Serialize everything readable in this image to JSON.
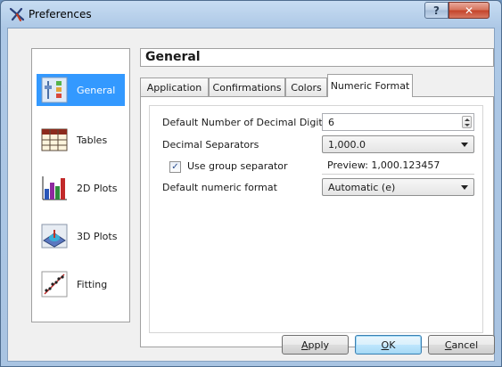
{
  "window": {
    "title": "Preferences",
    "help_glyph": "?",
    "close_glyph": "✕"
  },
  "sidebar": {
    "items": [
      {
        "label": "General",
        "icon": "general-icon",
        "active": true
      },
      {
        "label": "Tables",
        "icon": "tables-icon",
        "active": false
      },
      {
        "label": "2D Plots",
        "icon": "2d-plots-icon",
        "active": false
      },
      {
        "label": "3D Plots",
        "icon": "3d-plots-icon",
        "active": false
      },
      {
        "label": "Fitting",
        "icon": "fitting-icon",
        "active": false
      }
    ]
  },
  "section": {
    "title": "General"
  },
  "tabs": [
    {
      "label": "Application",
      "active": false
    },
    {
      "label": "Confirmations",
      "active": false
    },
    {
      "label": "Colors",
      "active": false
    },
    {
      "label": "Numeric Format",
      "active": true
    }
  ],
  "numeric_format": {
    "decimal_digits_label": "Default Number of Decimal Digits",
    "decimal_digits_value": "6",
    "decimal_separators_label": "Decimal Separators",
    "decimal_separators_value": "1,000.0",
    "group_separator_label": "Use group separator",
    "group_separator_checked": true,
    "check_glyph": "✓",
    "preview_text": "Preview: 1,000.123457",
    "default_format_label": "Default numeric format",
    "default_format_value": "Automatic (e)"
  },
  "buttons": {
    "apply": {
      "accel": "A",
      "rest": "pply"
    },
    "ok": {
      "accel": "O",
      "rest": "K"
    },
    "cancel": {
      "accel": "C",
      "rest": "ancel"
    }
  },
  "colors": {
    "selection": "#3399ff",
    "titlebar": "#adc8e6",
    "close": "#c4432a"
  }
}
